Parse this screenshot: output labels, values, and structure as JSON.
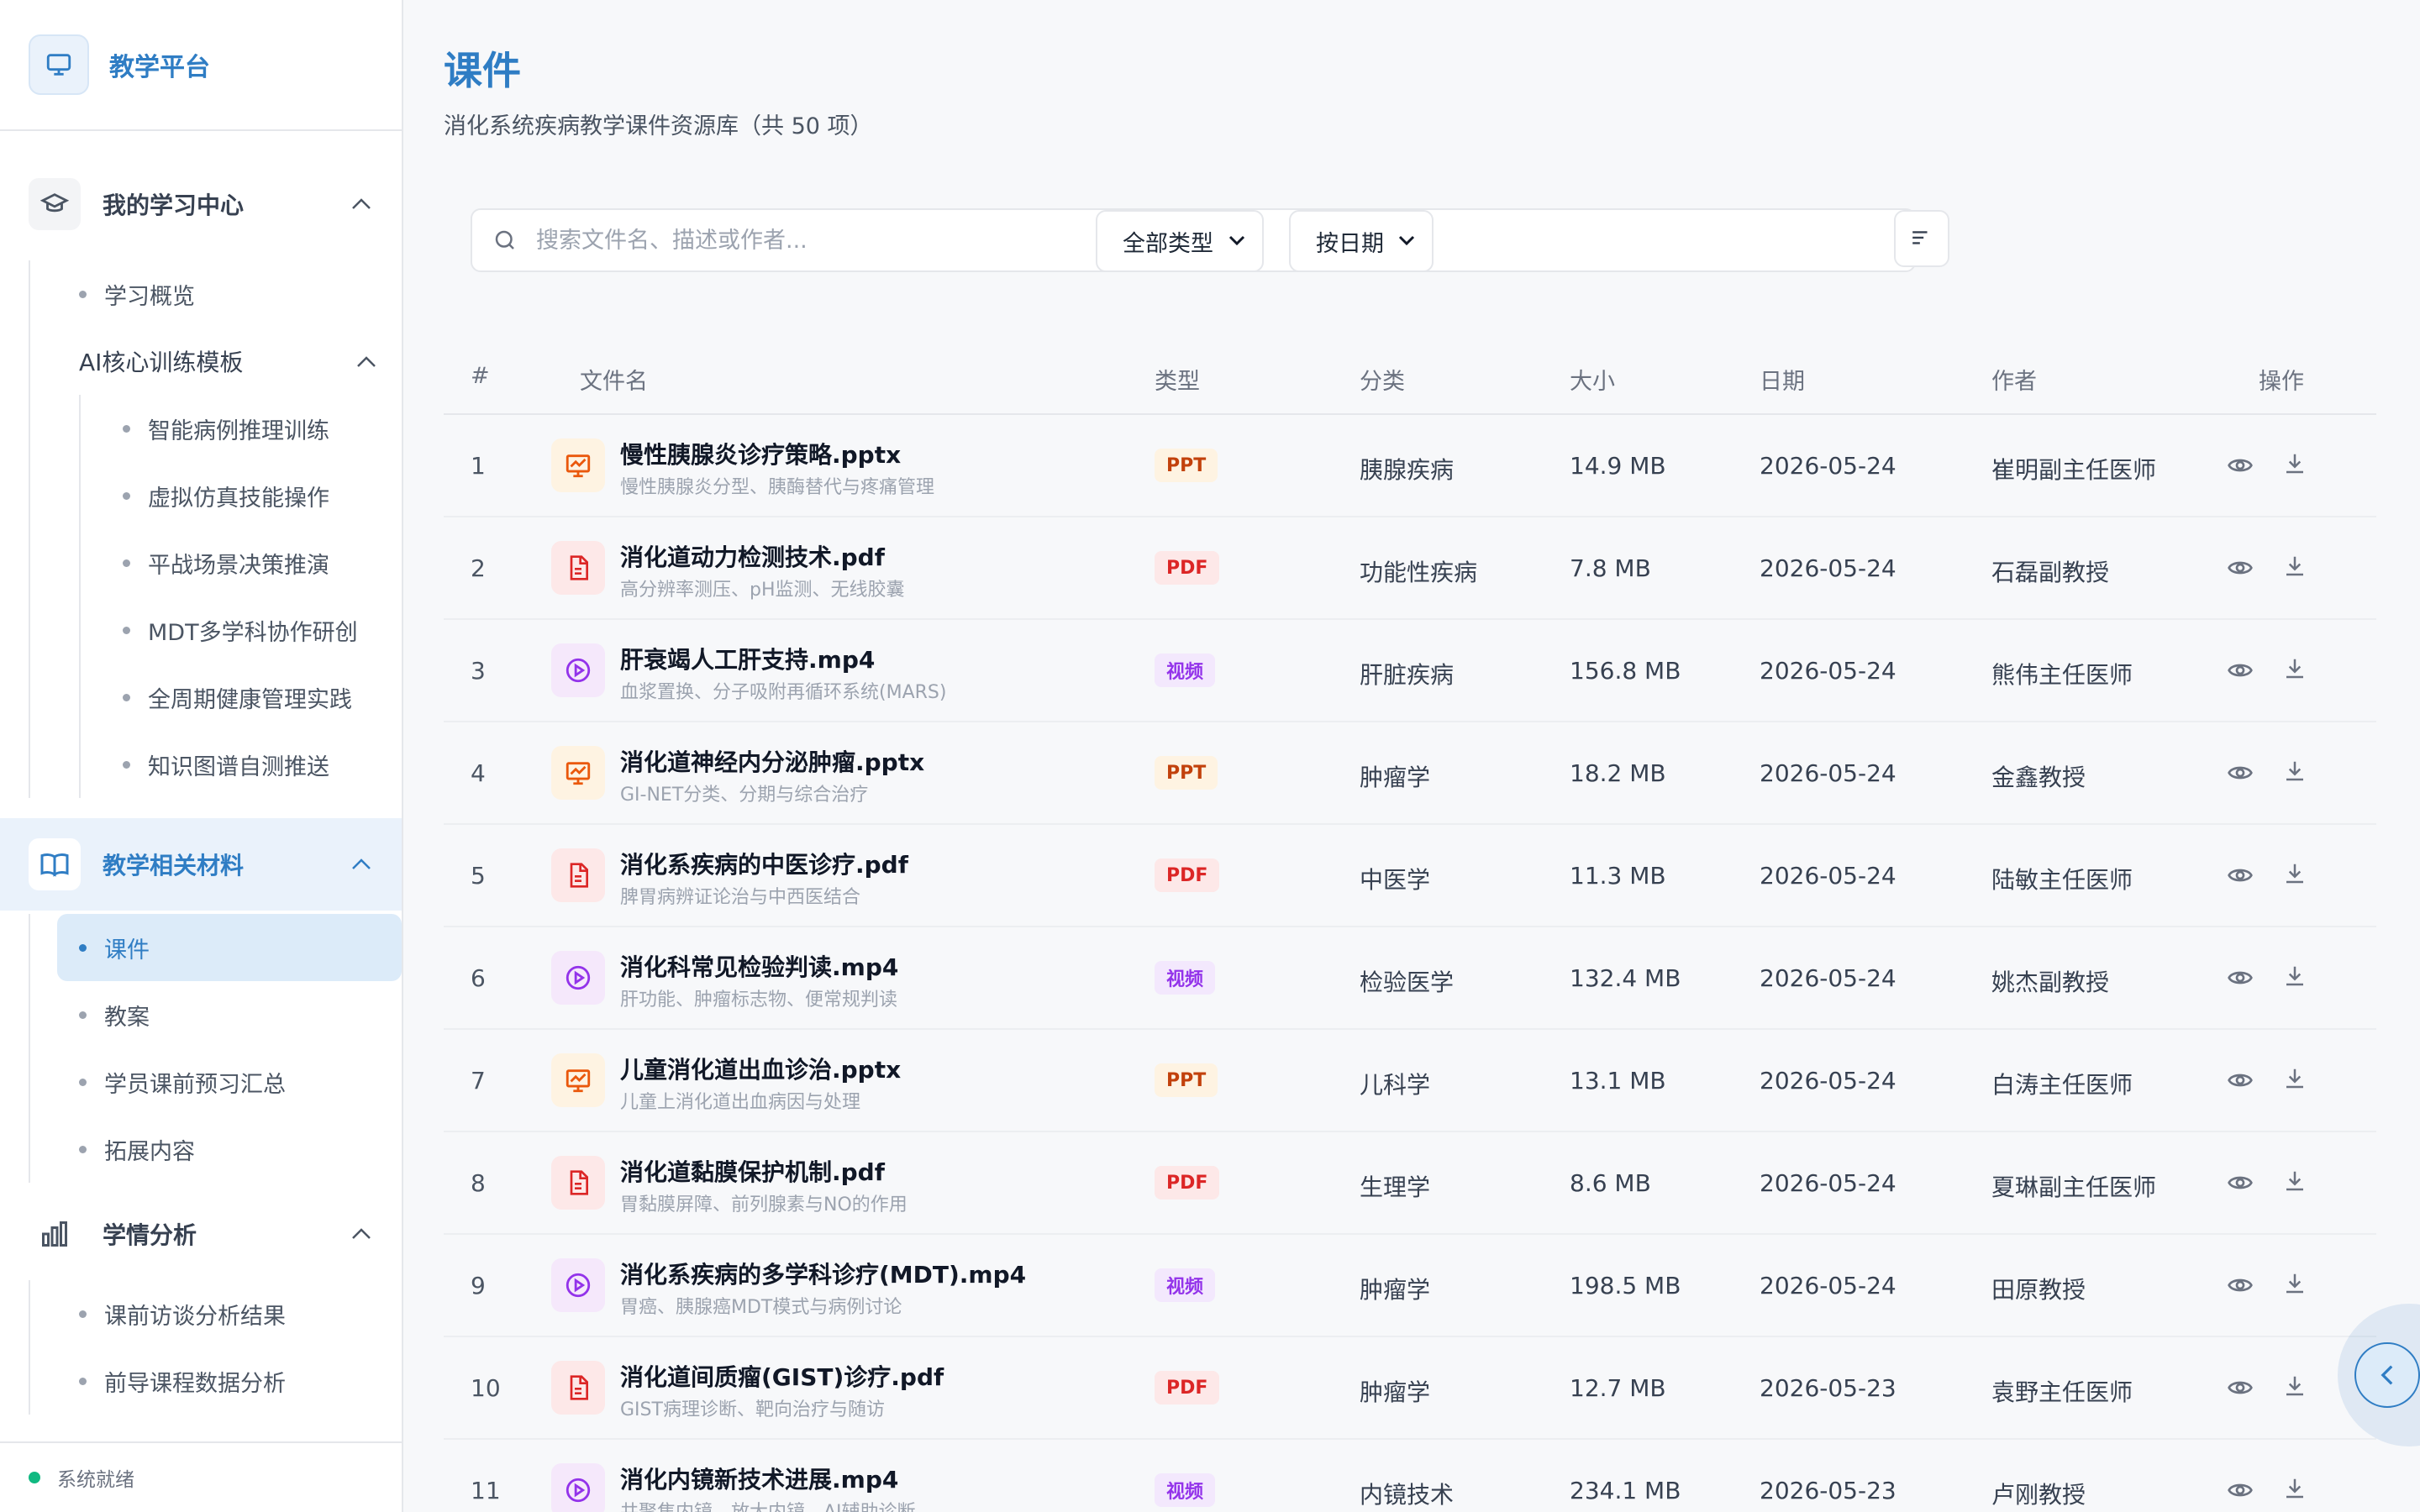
{
  "app": {
    "title": "教学平台"
  },
  "sidebar": {
    "groups": [
      {
        "label": "我的学习中心",
        "items": [
          "学习概览"
        ],
        "subgroup": {
          "label": "AI核心训练模板",
          "items": [
            "智能病例推理训练",
            "虚拟仿真技能操作",
            "平战场景决策推演",
            "MDT多学科协作研创",
            "全周期健康管理实践",
            "知识图谱自测推送"
          ]
        }
      },
      {
        "label": "教学相关材料",
        "items": [
          "课件",
          "教案",
          "学员课前预习汇总",
          "拓展内容"
        ],
        "active_item": "课件"
      },
      {
        "label": "学情分析",
        "items": [
          "课前访谈分析结果",
          "前导课程数据分析"
        ]
      }
    ],
    "status": "系统就绪"
  },
  "page": {
    "title": "课件",
    "subtitle": "消化系统疾病教学课件资源库（共 50 项）"
  },
  "toolbar": {
    "search_placeholder": "搜索文件名、描述或作者...",
    "type_filter": "全部类型",
    "sort_select": "按日期"
  },
  "table": {
    "headers": [
      "#",
      "文件名",
      "类型",
      "分类",
      "大小",
      "日期",
      "作者",
      "操作"
    ],
    "rows": [
      {
        "num": "1",
        "name": "慢性胰腺炎诊疗策略.pptx",
        "desc": "慢性胰腺炎分型、胰酶替代与疼痛管理",
        "type": "PPT",
        "category": "胰腺疾病",
        "size": "14.9 MB",
        "date": "2026-05-24",
        "author": "崔明副主任医师"
      },
      {
        "num": "2",
        "name": "消化道动力检测技术.pdf",
        "desc": "高分辨率测压、pH监测、无线胶囊",
        "type": "PDF",
        "category": "功能性疾病",
        "size": "7.8 MB",
        "date": "2026-05-24",
        "author": "石磊副教授"
      },
      {
        "num": "3",
        "name": "肝衰竭人工肝支持.mp4",
        "desc": "血浆置换、分子吸附再循环系统(MARS)",
        "type": "视频",
        "category": "肝脏疾病",
        "size": "156.8 MB",
        "date": "2026-05-24",
        "author": "熊伟主任医师"
      },
      {
        "num": "4",
        "name": "消化道神经内分泌肿瘤.pptx",
        "desc": "GI-NET分类、分期与综合治疗",
        "type": "PPT",
        "category": "肿瘤学",
        "size": "18.2 MB",
        "date": "2026-05-24",
        "author": "金鑫教授"
      },
      {
        "num": "5",
        "name": "消化系疾病的中医诊疗.pdf",
        "desc": "脾胃病辨证论治与中西医结合",
        "type": "PDF",
        "category": "中医学",
        "size": "11.3 MB",
        "date": "2026-05-24",
        "author": "陆敏主任医师"
      },
      {
        "num": "6",
        "name": "消化科常见检验判读.mp4",
        "desc": "肝功能、肿瘤标志物、便常规判读",
        "type": "视频",
        "category": "检验医学",
        "size": "132.4 MB",
        "date": "2026-05-24",
        "author": "姚杰副教授"
      },
      {
        "num": "7",
        "name": "儿童消化道出血诊治.pptx",
        "desc": "儿童上消化道出血病因与处理",
        "type": "PPT",
        "category": "儿科学",
        "size": "13.1 MB",
        "date": "2026-05-24",
        "author": "白涛主任医师"
      },
      {
        "num": "8",
        "name": "消化道黏膜保护机制.pdf",
        "desc": "胃黏膜屏障、前列腺素与NO的作用",
        "type": "PDF",
        "category": "生理学",
        "size": "8.6 MB",
        "date": "2026-05-24",
        "author": "夏琳副主任医师"
      },
      {
        "num": "9",
        "name": "消化系疾病的多学科诊疗(MDT).mp4",
        "desc": "胃癌、胰腺癌MDT模式与病例讨论",
        "type": "视频",
        "category": "肿瘤学",
        "size": "198.5 MB",
        "date": "2026-05-24",
        "author": "田原教授"
      },
      {
        "num": "10",
        "name": "消化道间质瘤(GIST)诊疗.pdf",
        "desc": "GIST病理诊断、靶向治疗与随访",
        "type": "PDF",
        "category": "肿瘤学",
        "size": "12.7 MB",
        "date": "2026-05-23",
        "author": "袁野主任医师"
      },
      {
        "num": "11",
        "name": "消化内镜新技术进展.mp4",
        "desc": "共聚焦内镜、放大内镜、AI辅助诊断",
        "type": "视频",
        "category": "内镜技术",
        "size": "234.1 MB",
        "date": "2026-05-23",
        "author": "卢刚教授"
      }
    ]
  },
  "colors": {
    "accent": "#2f7dc4",
    "ppt": "#ea580c",
    "pdf": "#dc2626",
    "video": "#9333ea",
    "status_ok": "#10b981"
  },
  "icons": {
    "brand": "monitor-icon",
    "learning_center": "graduation-cap-icon",
    "materials": "book-open-icon",
    "analytics": "bar-chart-icon",
    "search": "search-icon",
    "sort": "sort-lines-icon",
    "view": "eye-icon",
    "download": "download-icon",
    "collapse": "chevron-left-icon"
  }
}
